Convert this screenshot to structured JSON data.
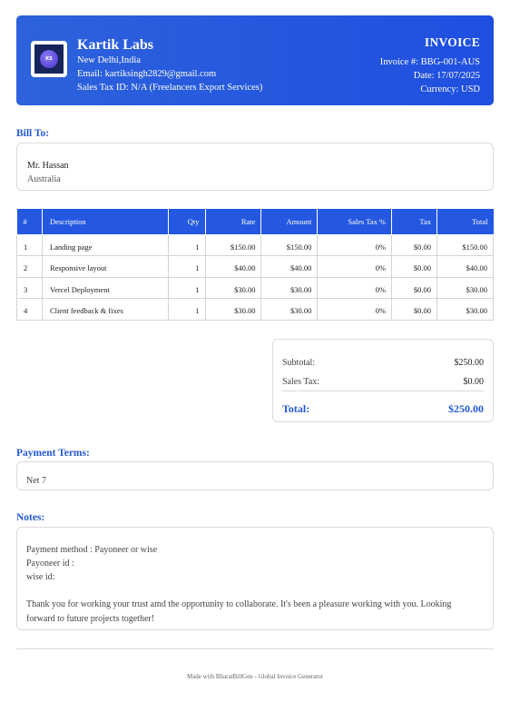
{
  "header": {
    "logo_initials": "KS",
    "company_name": "Kartik Labs",
    "location": "New Delhi,India",
    "email": "Email: kartiksingh2829@gmail.com",
    "tax_id": "Sales Tax ID: N/A (Freelancers Export Services)",
    "invoice_title": "INVOICE",
    "invoice_number": "Invoice #: BBG-001-AUS",
    "date": "Date: 17/07/2025",
    "currency": "Currency: USD",
    "accent_color": "#2458e0"
  },
  "bill_to": {
    "title": "Bill To:",
    "name": "Mr. Hassan",
    "country": "Australia"
  },
  "items_table": {
    "headers": [
      "#",
      "Description",
      "Qty",
      "Rate",
      "Amount",
      "Sales Tax %",
      "Tax",
      "Total"
    ],
    "rows": [
      {
        "num": "1",
        "description": "Landing page",
        "qty": "1",
        "rate": "$150.00",
        "amount": "$150.00",
        "tax_pct": "0%",
        "tax": "$0.00",
        "total": "$150.00"
      },
      {
        "num": "2",
        "description": "Responsive layout",
        "qty": "1",
        "rate": "$40.00",
        "amount": "$40.00",
        "tax_pct": "0%",
        "tax": "$0.00",
        "total": "$40.00"
      },
      {
        "num": "3",
        "description": "Vercel Deployment",
        "qty": "1",
        "rate": "$30.00",
        "amount": "$30.00",
        "tax_pct": "0%",
        "tax": "$0.00",
        "total": "$30.00"
      },
      {
        "num": "4",
        "description": "Client feedback & fixes",
        "qty": "1",
        "rate": "$30.00",
        "amount": "$30.00",
        "tax_pct": "0%",
        "tax": "$0.00",
        "total": "$30.00"
      }
    ]
  },
  "totals": {
    "subtotal_label": "Subtotal:",
    "subtotal_value": "$250.00",
    "sales_tax_label": "Sales Tax:",
    "sales_tax_value": "$0.00",
    "total_label": "Total:",
    "total_value": "$250.00"
  },
  "payment_terms": {
    "title": "Payment Terms:",
    "text": "Net 7"
  },
  "notes": {
    "title": "Notes:",
    "line1": "Payment method : Payoneer or wise",
    "line2": "Payoneer id :",
    "line3": "wise id:",
    "thanks": "Thank you for working your trust amd the opportunity to collaborate. It's been a pleasure working with you. Looking forward to future projects together!"
  },
  "footer": {
    "text": "Made with BharatBillGen - Global Invoice Generator"
  }
}
